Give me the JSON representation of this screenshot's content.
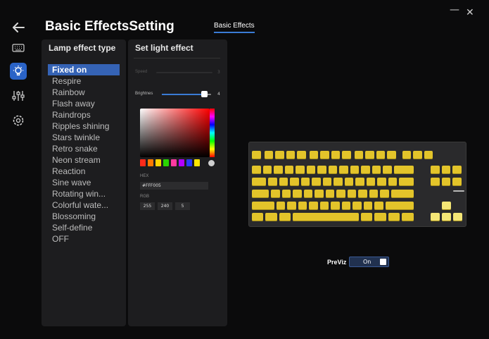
{
  "window": {
    "minimize_glyph": "—",
    "close_glyph": "✕"
  },
  "header": {
    "title": "Basic EffectsSetting",
    "tab_label": "Basic Effects"
  },
  "sidebar": {
    "items": [
      {
        "icon": "back-arrow-icon"
      },
      {
        "icon": "keyboard-icon"
      },
      {
        "icon": "lightbulb-icon",
        "active": true
      },
      {
        "icon": "sliders-icon"
      },
      {
        "icon": "gear-icon"
      }
    ]
  },
  "effects_panel": {
    "title": "Lamp effect type",
    "selected": "Fixed on",
    "items": [
      "Fixed on",
      "Respire",
      "Rainbow",
      "Flash away",
      "Raindrops",
      "Ripples shining",
      "Stars twinkle",
      "Retro snake",
      "Neon stream",
      "Reaction",
      "Sine wave",
      "Rotating win...",
      "Colorful wate...",
      "Blossoming",
      "Self-define",
      "OFF"
    ]
  },
  "light_panel": {
    "title": "Set light effect",
    "speed_label": "Speed",
    "speed_value": "3",
    "brightness_label": "Brightnes",
    "brightness_value": "4",
    "brightness_fraction": 0.85,
    "hex_label": "HEX",
    "hex_value": "#FFF005",
    "rgb_label": "RGB",
    "rgb": [
      "255",
      "240",
      "5"
    ],
    "swatch_colors": [
      "#ff2a1a",
      "#ff7a00",
      "#ffd400",
      "#2ad400",
      "#ff3aa0",
      "#b400ff",
      "#2a3aff",
      "#ffe600"
    ]
  },
  "preview": {
    "label": "PreViz",
    "toggle_text": "On",
    "key_color": "#e3c42a",
    "key_highlight": "#f4e676"
  }
}
